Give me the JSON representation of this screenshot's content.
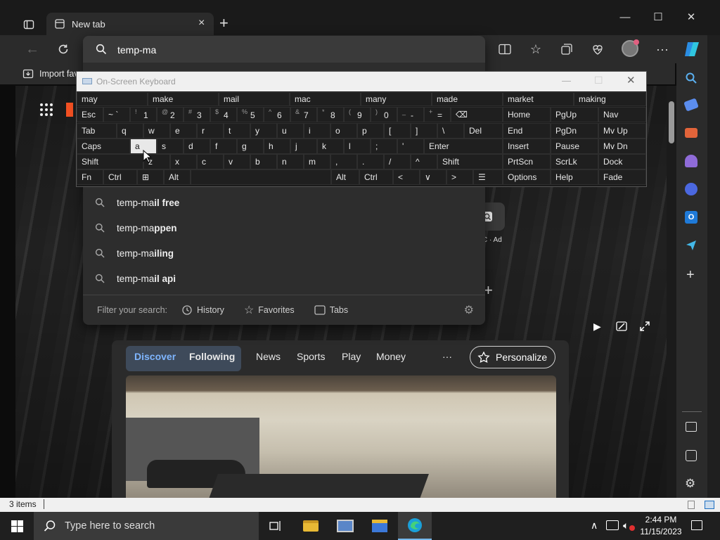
{
  "browser": {
    "tab_title": "New tab",
    "address_text": "temp-ma",
    "fav_bar_item": "Import fav"
  },
  "suggestions": [
    {
      "prefix": "temp-ma",
      "bold": "il free"
    },
    {
      "prefix": "temp-ma",
      "bold": "ppen"
    },
    {
      "prefix": "temp-ma",
      "bold": "iling"
    },
    {
      "prefix": "temp-ma",
      "bold": "il api"
    }
  ],
  "filter": {
    "label": "Filter your search:",
    "history": "History",
    "favorites": "Favorites",
    "tabs": "Tabs"
  },
  "ad_label": "C · Ad",
  "feed": {
    "discover": "Discover",
    "following": "Following",
    "news": "News",
    "sports": "Sports",
    "play": "Play",
    "money": "Money",
    "more": "···",
    "personalize": "Personalize"
  },
  "osk": {
    "title": "On-Screen Keyboard",
    "predictions": [
      "may",
      "make",
      "mail",
      "mac",
      "many",
      "made",
      "market",
      "making"
    ],
    "row1": [
      [
        "Esc",
        ""
      ],
      [
        "~ `",
        ""
      ],
      [
        "1",
        "!"
      ],
      [
        "2",
        "@"
      ],
      [
        "3",
        "#"
      ],
      [
        "4",
        "$"
      ],
      [
        "5",
        "%"
      ],
      [
        "6",
        "^"
      ],
      [
        "7",
        "&"
      ],
      [
        "8",
        "*"
      ],
      [
        "9",
        "("
      ],
      [
        "0",
        ")"
      ],
      [
        "-",
        "_"
      ],
      [
        "=",
        "+"
      ],
      [
        "⌫",
        ""
      ]
    ],
    "row2": [
      "Tab",
      "q",
      "w",
      "e",
      "r",
      "t",
      "y",
      "u",
      "i",
      "o",
      "p",
      "[",
      "]",
      "\\",
      "Del"
    ],
    "row3": [
      "Caps",
      "a",
      "s",
      "d",
      "f",
      "g",
      "h",
      "j",
      "k",
      "l",
      ";",
      "'",
      "Enter"
    ],
    "row4": [
      "Shift",
      "z",
      "x",
      "c",
      "v",
      "b",
      "n",
      "m",
      ",",
      ".",
      "/",
      "^",
      "Shift"
    ],
    "row5": [
      "Fn",
      "Ctrl",
      "⊞",
      "Alt",
      "",
      "Alt",
      "Ctrl",
      "<",
      "∨",
      ">",
      "☰"
    ],
    "nav_keys": [
      [
        "Home",
        "PgUp",
        "Nav"
      ],
      [
        "End",
        "PgDn",
        "Mv Up"
      ],
      [
        "Insert",
        "Pause",
        "Mv Dn"
      ],
      [
        "PrtScn",
        "ScrLk",
        "Dock"
      ],
      [
        "Options",
        "Help",
        "Fade"
      ]
    ]
  },
  "status": {
    "items": "3 items"
  },
  "taskbar": {
    "search_placeholder": "Type here to search",
    "time": "2:44 PM",
    "date": "11/15/2023"
  }
}
